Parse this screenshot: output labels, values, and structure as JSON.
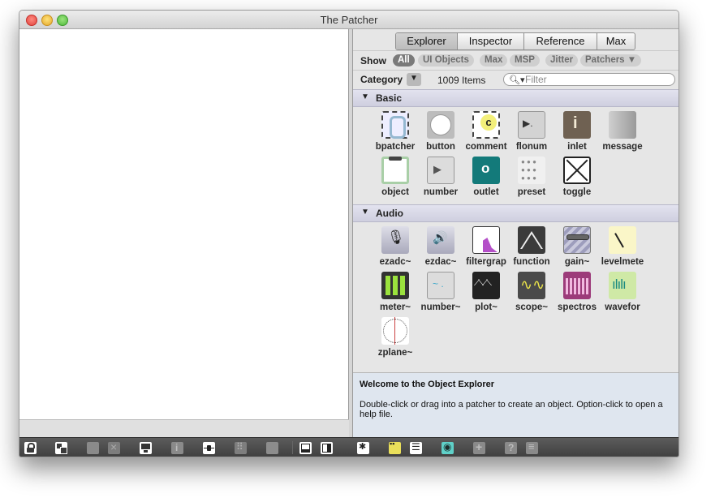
{
  "window": {
    "title": "The Patcher"
  },
  "tabs": [
    {
      "label": "Explorer",
      "selected": true
    },
    {
      "label": "Inspector",
      "selected": false
    },
    {
      "label": "Reference",
      "selected": false
    },
    {
      "label": "Max",
      "selected": false
    }
  ],
  "show": {
    "label": "Show",
    "filters": [
      {
        "label": "All",
        "selected": true
      },
      {
        "label": "UI Objects",
        "selected": false
      },
      {
        "label": "Max",
        "selected": false
      },
      {
        "label": "MSP",
        "selected": false
      },
      {
        "label": "Jitter",
        "selected": false
      },
      {
        "label": "Patchers ▼",
        "selected": false
      }
    ]
  },
  "category": {
    "label": "Category",
    "count": "1009 Items",
    "filter_placeholder": "Filter"
  },
  "sections": [
    {
      "title": "Basic",
      "items": [
        "bpatcher",
        "button",
        "comment",
        "flonum",
        "inlet",
        "message",
        "object",
        "number",
        "outlet",
        "preset",
        "toggle"
      ]
    },
    {
      "title": "Audio",
      "items": [
        "ezadc~",
        "ezdac~",
        "filtergrap",
        "function",
        "gain~",
        "levelmete",
        "meter~",
        "number~",
        "plot~",
        "scope~",
        "spectros",
        "wavefor",
        "zplane~"
      ]
    }
  ],
  "description": {
    "title": "Welcome to the Object Explorer",
    "body": "Double-click or drag into a patcher to create an object. Option-click to open a help file."
  },
  "colors": {
    "section_header": "#d8d8e6",
    "description_bg": "#dfe6ef",
    "toolbar_bg": "#4a4a4a"
  },
  "icons": {
    "patcher_toolbar": [
      "lock-icon",
      "presentation-icon",
      "paste-icon",
      "delete-icon",
      "monitor-icon",
      "info-icon",
      "slider-icon",
      "grid-icon",
      "gear-icon",
      "bottom-panel-icon",
      "right-panel-icon"
    ],
    "explorer_toolbar": [
      "action-menu-icon",
      "grid-view-icon",
      "list-view-icon",
      "eye-icon",
      "add-icon",
      "help-icon",
      "menu-icon"
    ]
  }
}
